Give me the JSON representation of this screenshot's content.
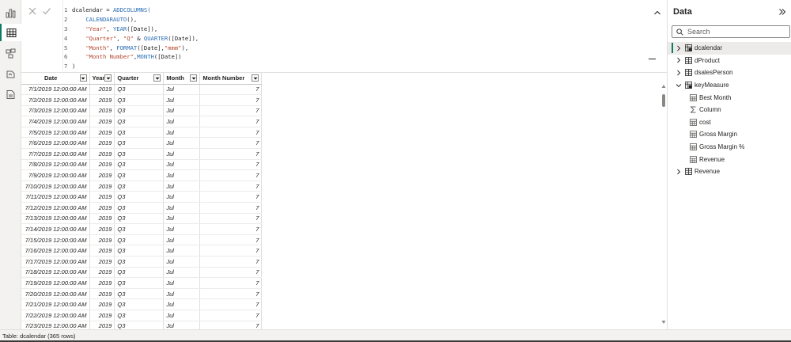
{
  "rail": [
    {
      "name": "report-view-icon",
      "active": false
    },
    {
      "name": "table-view-icon",
      "active": true
    },
    {
      "name": "model-view-icon",
      "active": false
    },
    {
      "name": "dax-query-icon",
      "active": false
    },
    {
      "name": "tmdl-view-icon",
      "active": false
    }
  ],
  "formula": {
    "lines": [
      {
        "n": "1",
        "parts": [
          {
            "t": "dcalendar = ",
            "c": ""
          },
          {
            "t": "ADDCOLUMNS(",
            "c": "fn"
          }
        ]
      },
      {
        "n": "2",
        "parts": [
          {
            "t": "    ",
            "c": ""
          },
          {
            "t": "CALENDARAUTO",
            "c": "fn"
          },
          {
            "t": "(),",
            "c": ""
          }
        ]
      },
      {
        "n": "3",
        "parts": [
          {
            "t": "    ",
            "c": ""
          },
          {
            "t": "\"Year\"",
            "c": "str"
          },
          {
            "t": ", ",
            "c": ""
          },
          {
            "t": "YEAR",
            "c": "fn"
          },
          {
            "t": "([Date]),",
            "c": ""
          }
        ]
      },
      {
        "n": "4",
        "parts": [
          {
            "t": "    ",
            "c": ""
          },
          {
            "t": "\"Quarter\"",
            "c": "str"
          },
          {
            "t": ", ",
            "c": ""
          },
          {
            "t": "\"Q\"",
            "c": "str"
          },
          {
            "t": " & ",
            "c": ""
          },
          {
            "t": "QUARTER",
            "c": "fn"
          },
          {
            "t": "([Date]),",
            "c": ""
          }
        ]
      },
      {
        "n": "5",
        "parts": [
          {
            "t": "    ",
            "c": ""
          },
          {
            "t": "\"Month\"",
            "c": "str"
          },
          {
            "t": ", ",
            "c": ""
          },
          {
            "t": "FORMAT",
            "c": "fn"
          },
          {
            "t": "([Date],",
            "c": ""
          },
          {
            "t": "\"mmm\"",
            "c": "str"
          },
          {
            "t": "),",
            "c": ""
          }
        ]
      },
      {
        "n": "6",
        "parts": [
          {
            "t": "    ",
            "c": ""
          },
          {
            "t": "\"Month Number\"",
            "c": "str"
          },
          {
            "t": ",",
            "c": ""
          },
          {
            "t": "MONTH",
            "c": "fn"
          },
          {
            "t": "([Date])",
            "c": ""
          }
        ]
      },
      {
        "n": "7",
        "parts": [
          {
            "t": ")",
            "c": ""
          }
        ]
      }
    ]
  },
  "grid": {
    "columns": [
      "Date",
      "Year",
      "Quarter",
      "Month",
      "Month Number"
    ],
    "rows": [
      [
        "7/1/2019 12:00:00 AM",
        "2019",
        "Q3",
        "Jul",
        "7"
      ],
      [
        "7/2/2019 12:00:00 AM",
        "2019",
        "Q3",
        "Jul",
        "7"
      ],
      [
        "7/3/2019 12:00:00 AM",
        "2019",
        "Q3",
        "Jul",
        "7"
      ],
      [
        "7/4/2019 12:00:00 AM",
        "2019",
        "Q3",
        "Jul",
        "7"
      ],
      [
        "7/5/2019 12:00:00 AM",
        "2019",
        "Q3",
        "Jul",
        "7"
      ],
      [
        "7/6/2019 12:00:00 AM",
        "2019",
        "Q3",
        "Jul",
        "7"
      ],
      [
        "7/7/2019 12:00:00 AM",
        "2019",
        "Q3",
        "Jul",
        "7"
      ],
      [
        "7/8/2019 12:00:00 AM",
        "2019",
        "Q3",
        "Jul",
        "7"
      ],
      [
        "7/9/2019 12:00:00 AM",
        "2019",
        "Q3",
        "Jul",
        "7"
      ],
      [
        "7/10/2019 12:00:00 AM",
        "2019",
        "Q3",
        "Jul",
        "7"
      ],
      [
        "7/11/2019 12:00:00 AM",
        "2019",
        "Q3",
        "Jul",
        "7"
      ],
      [
        "7/12/2019 12:00:00 AM",
        "2019",
        "Q3",
        "Jul",
        "7"
      ],
      [
        "7/13/2019 12:00:00 AM",
        "2019",
        "Q3",
        "Jul",
        "7"
      ],
      [
        "7/14/2019 12:00:00 AM",
        "2019",
        "Q3",
        "Jul",
        "7"
      ],
      [
        "7/15/2019 12:00:00 AM",
        "2019",
        "Q3",
        "Jul",
        "7"
      ],
      [
        "7/16/2019 12:00:00 AM",
        "2019",
        "Q3",
        "Jul",
        "7"
      ],
      [
        "7/17/2019 12:00:00 AM",
        "2019",
        "Q3",
        "Jul",
        "7"
      ],
      [
        "7/18/2019 12:00:00 AM",
        "2019",
        "Q3",
        "Jul",
        "7"
      ],
      [
        "7/19/2019 12:00:00 AM",
        "2019",
        "Q3",
        "Jul",
        "7"
      ],
      [
        "7/20/2019 12:00:00 AM",
        "2019",
        "Q3",
        "Jul",
        "7"
      ],
      [
        "7/21/2019 12:00:00 AM",
        "2019",
        "Q3",
        "Jul",
        "7"
      ],
      [
        "7/22/2019 12:00:00 AM",
        "2019",
        "Q3",
        "Jul",
        "7"
      ],
      [
        "7/23/2019 12:00:00 AM",
        "2019",
        "Q3",
        "Jul",
        "7"
      ]
    ]
  },
  "pane": {
    "title": "Data",
    "search_placeholder": "Search",
    "tree": [
      {
        "label": "dcalendar",
        "level": 0,
        "expanded": false,
        "selected": true,
        "icon": "calc-table-icon"
      },
      {
        "label": "dProduct",
        "level": 0,
        "expanded": false,
        "selected": false,
        "icon": "table-icon"
      },
      {
        "label": "dsalesPerson",
        "level": 0,
        "expanded": false,
        "selected": false,
        "icon": "table-icon"
      },
      {
        "label": "keyMeasure",
        "level": 0,
        "expanded": true,
        "selected": false,
        "icon": "calc-table-icon"
      },
      {
        "label": "Best Month",
        "level": 1,
        "icon": "measure-icon"
      },
      {
        "label": "Column",
        "level": 1,
        "icon": "sigma-icon"
      },
      {
        "label": "cost",
        "level": 1,
        "icon": "measure-icon"
      },
      {
        "label": "Gross Margin",
        "level": 1,
        "icon": "measure-icon"
      },
      {
        "label": "Gross Margin %",
        "level": 1,
        "icon": "measure-icon"
      },
      {
        "label": "Revenue",
        "level": 1,
        "icon": "measure-icon"
      },
      {
        "label": "Revenue",
        "level": 0,
        "expanded": false,
        "selected": false,
        "icon": "table-icon"
      }
    ]
  },
  "status": {
    "text": "Table: dcalendar (365 rows)"
  },
  "colors": {
    "accent": "#117865",
    "function": "#2b6db5",
    "string": "#b5452b"
  }
}
